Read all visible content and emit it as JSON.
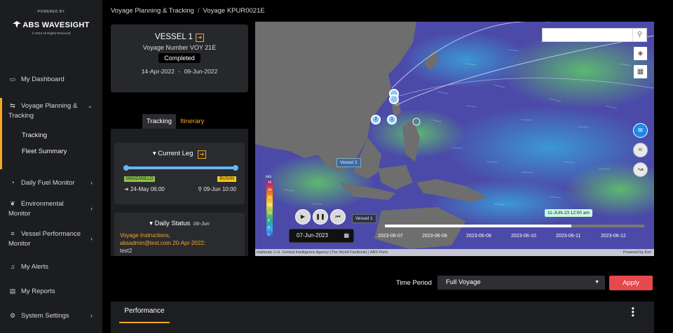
{
  "brand": {
    "powered_by": "POWERED BY",
    "logo": "ABS WAVESIGHT",
    "rights": "© 2023 All Rights Reserved"
  },
  "sidebar": {
    "items": [
      {
        "label": "My Dashboard",
        "icon": "monitor-icon"
      },
      {
        "label": "Voyage Planning &",
        "label2": "Tracking",
        "icon": "route-icon"
      },
      {
        "label": "Daily Fuel Monitor",
        "icon": "gauge-icon"
      },
      {
        "label": "Environmental",
        "label2": "Monitor",
        "icon": "leaf-icon"
      },
      {
        "label": "Vessel Performance",
        "label2": "Monitor",
        "icon": "sliders-icon"
      },
      {
        "label": "My Alerts",
        "icon": "bell-icon"
      },
      {
        "label": "My Reports",
        "icon": "document-icon"
      },
      {
        "label": "System Settings",
        "icon": "gear-icon"
      }
    ],
    "subitems": [
      "Tracking",
      "Fleet Summary"
    ]
  },
  "breadcrumb": {
    "parent": "Voyage Planning & Tracking",
    "sep": "/",
    "current": "Voyage KPUR0021E"
  },
  "vessel": {
    "name": "VESSEL 1",
    "voyage": "Voyage Number VOY 21E",
    "status": "Completed",
    "start": "14-Apr-2022",
    "dash": "-",
    "end": "09-Jun-2022"
  },
  "tabs": {
    "tracking": "Tracking",
    "itinerary": "Itinerary"
  },
  "current_leg": {
    "title": "Current Leg",
    "progress": 1.0,
    "from_port": "MANZANILLO",
    "to_port": "BUSAN",
    "departure": "24-May 06:00",
    "arrival": "09-Jun 10:00"
  },
  "daily_status": {
    "title": "Daily Status",
    "date": "06-Jun",
    "line1": "Voyage Instructions,",
    "line2": "absadmin@test.com 20-Apr-2022:",
    "note": "test2"
  },
  "map": {
    "legend_unit": "m/s",
    "legend_ticks": [
      "42",
      "34",
      "26",
      "18",
      "12",
      "8",
      "4",
      "0"
    ],
    "current_date": "07-Jun-2023",
    "timeline_labels": [
      "2023-06-07",
      "2023-06-08",
      "2023-06-09",
      "2023-06-10",
      "2023-06-11",
      "2023-06-12"
    ],
    "timeline_tip": "11-JUN-23 12:00 am",
    "timeline_progress": 0.72,
    "vessel_tag_1": "Vessel 1",
    "vessel_tag_2": "Vessel 2",
    "pin_a": "2",
    "pin_b": "1",
    "attribution": "rnational; U.S. Central Intelligence Agency (The World Factbook) | ABS Ports",
    "powered": "Powered by Esri"
  },
  "time_period": {
    "label": "Time Period",
    "value": "Full Voyage",
    "apply": "Apply"
  },
  "performance": {
    "tab": "Performance"
  }
}
